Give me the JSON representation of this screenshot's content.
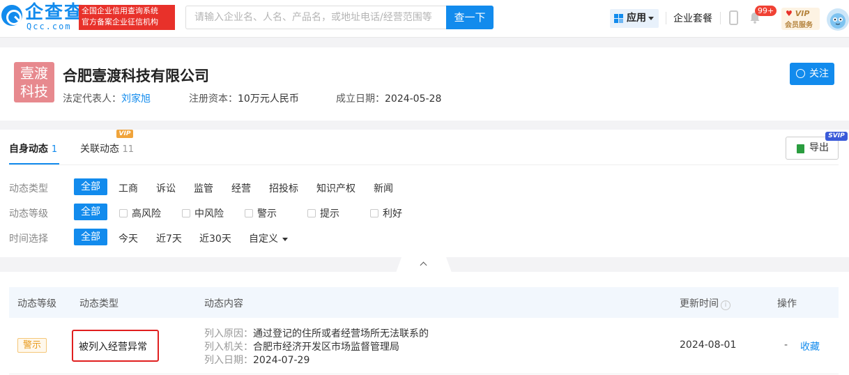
{
  "header": {
    "logo_text": "企查查",
    "logo_sub": "Qcc.com",
    "slogan_line1": "全国企业信用查询系统",
    "slogan_line2": "官方备案企业征信机构",
    "search_placeholder": "请输入企业名、人名、产品名，或地址电话/经营范围等",
    "search_button": "查一下",
    "apps_label": "应用",
    "package_label": "企业套餐",
    "notification_count": "99+",
    "vip_label": "VIP",
    "vip_sub": "会员服务"
  },
  "company": {
    "logo_line1": "壹渡",
    "logo_line2": "科技",
    "name": "合肥壹渡科技有限公司",
    "legal_rep_label": "法定代表人：",
    "legal_rep": "刘家旭",
    "capital_label": "注册资本：",
    "capital": "10万元人民币",
    "founded_label": "成立日期：",
    "founded": "2024-05-28",
    "follow_label": "关注"
  },
  "tabs": [
    {
      "label": "自身动态",
      "count": "1"
    },
    {
      "label": "关联动态",
      "count": "11",
      "tag": "VIP"
    }
  ],
  "export": {
    "label": "导出",
    "tag": "SVIP"
  },
  "filters": {
    "type": {
      "label": "动态类型",
      "active": "全部",
      "options": [
        "工商",
        "诉讼",
        "监管",
        "经营",
        "招投标",
        "知识产权",
        "新闻"
      ]
    },
    "level": {
      "label": "动态等级",
      "active": "全部",
      "options": [
        "高风险",
        "中风险",
        "警示",
        "提示",
        "利好"
      ]
    },
    "time": {
      "label": "时间选择",
      "active": "全部",
      "options": [
        "今天",
        "近7天",
        "近30天",
        "自定义"
      ]
    }
  },
  "table": {
    "headers": [
      "动态等级",
      "动态类型",
      "动态内容",
      "更新时间",
      "操作"
    ],
    "rows": [
      {
        "level": "警示",
        "type": "被列入经营异常",
        "reason_label": "列入原因：",
        "reason": "通过登记的住所或者经营场所无法联系的",
        "authority_label": "列入机关：",
        "authority": "合肥市经济开发区市场监督管理局",
        "date_label": "列入日期：",
        "date": "2024-07-29",
        "updated": "2024-08-01",
        "op_dash": "-",
        "op_fav": "收藏"
      }
    ]
  },
  "colors": {
    "accent": "#128bed",
    "warning": "#e89a1c",
    "highlight": "#e01f1f"
  }
}
